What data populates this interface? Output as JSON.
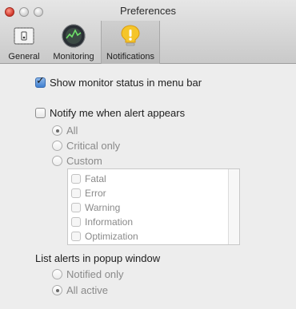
{
  "window": {
    "title": "Preferences"
  },
  "toolbar": {
    "items": [
      {
        "label": "General",
        "icon": "switch-icon"
      },
      {
        "label": "Monitoring",
        "icon": "monitor-gauge-icon"
      },
      {
        "label": "Notifications",
        "icon": "notification-lightbulb-icon",
        "selected": true
      }
    ]
  },
  "options": {
    "show_status": {
      "label": "Show monitor status in menu bar",
      "checked": true
    },
    "notify": {
      "label": "Notify me when alert appears",
      "checked": false
    },
    "notify_level": {
      "options": [
        "All",
        "Critical only",
        "Custom"
      ],
      "selected": "All"
    },
    "custom_list": {
      "items": [
        "Fatal",
        "Error",
        "Warning",
        "Information",
        "Optimization"
      ]
    },
    "popup": {
      "label": "List alerts in popup window",
      "options": [
        "Notified only",
        "All active"
      ],
      "selected": "All active"
    }
  },
  "colors": {
    "accent": "#3f7fd0",
    "selected_tab": "#c4c4c4",
    "close_button": "#d0362a"
  }
}
